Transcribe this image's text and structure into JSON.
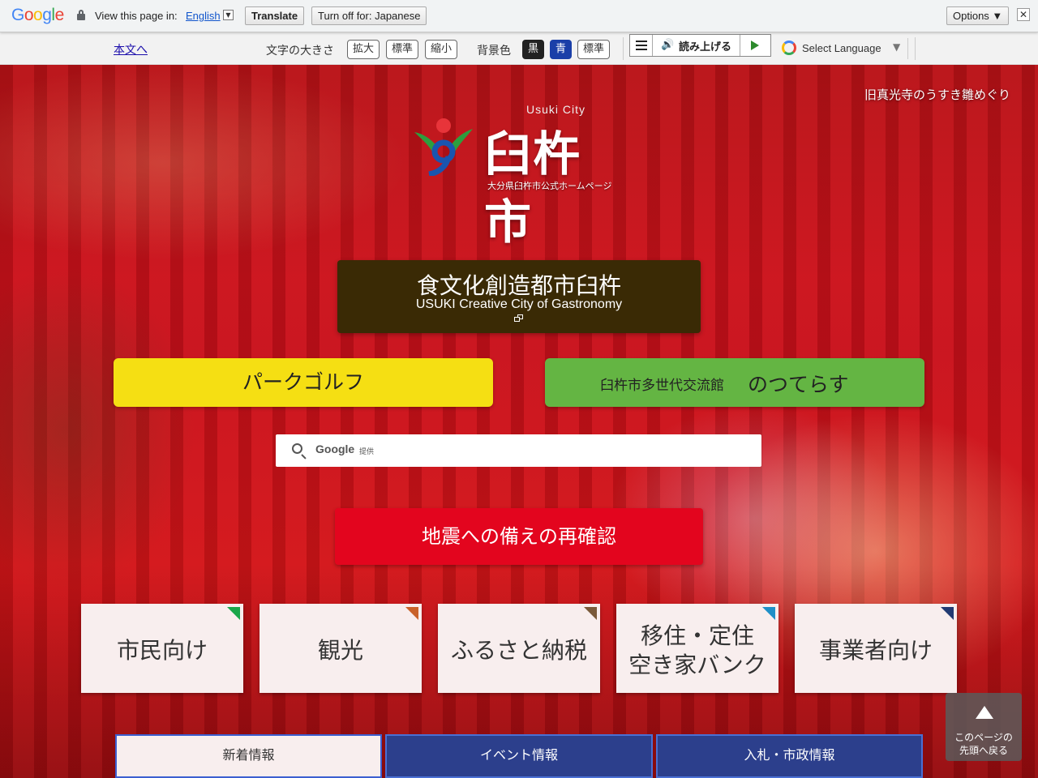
{
  "translate_bar": {
    "logo_letters": [
      {
        "ch": "G",
        "color": "#4285f4"
      },
      {
        "ch": "o",
        "color": "#ea4335"
      },
      {
        "ch": "o",
        "color": "#fbbc05"
      },
      {
        "ch": "g",
        "color": "#4285f4"
      },
      {
        "ch": "l",
        "color": "#34a853"
      },
      {
        "ch": "e",
        "color": "#ea4335"
      }
    ],
    "view_in": "View this page in:",
    "language": "English",
    "dropdown_arrow": "▼",
    "translate": "Translate",
    "turn_off": "Turn off for: Japanese",
    "options": "Options ▼",
    "close": "✕"
  },
  "access_bar": {
    "skip_link": "本文へ",
    "text_size_label": "文字の大きさ",
    "enlarge": "拡大",
    "standard": "標準",
    "shrink": "縮小",
    "bg_label": "背景色",
    "bg_black": "黒",
    "bg_blue": "青",
    "bg_standard": "標準",
    "read_aloud": "読み上げる",
    "speaker_icon": "🔊",
    "select_language": "Select Language",
    "select_arrow": "▼"
  },
  "hero": {
    "caption": "旧真光寺のうすき雛めぐり",
    "logo_en": "Usuki City",
    "logo_ja": "臼杵市",
    "logo_sub": "大分県臼杵市公式ホームページ",
    "gastronomy_ja": "食文化創造都市臼杵",
    "gastronomy_en": "USUKI Creative City of Gastronomy",
    "park_golf": "パークゴルフ",
    "notsuterasu_a": "臼杵市多世代交流館",
    "notsuterasu_b": "のつてらす",
    "search_brand": "Google",
    "search_provided": "提供",
    "earthquake": "地震への備えの再確認"
  },
  "categories": [
    {
      "label": "市民向け",
      "color": "#1aa64a"
    },
    {
      "label": "観光",
      "color": "#c9622a"
    },
    {
      "label": "ふるさと納税",
      "color": "#7a5a3a"
    },
    {
      "label_1": "移住・定住",
      "label_2": "空き家バンク",
      "color": "#1f8fc7"
    },
    {
      "label": "事業者向け",
      "color": "#223a72"
    }
  ],
  "tabs": [
    "新着情報",
    "イベント情報",
    "入札・市政情報"
  ],
  "to_top": {
    "line1": "このページの",
    "line2": "先頭へ戻る"
  }
}
